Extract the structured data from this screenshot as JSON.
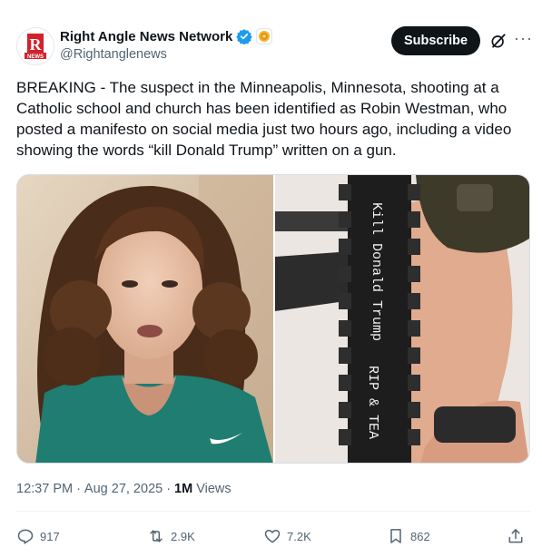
{
  "account": {
    "name": "Right Angle News Network",
    "handle": "@Rightanglenews",
    "avatar_letter": "R",
    "avatar_subtext": "NEWS"
  },
  "header": {
    "subscribe_label": "Subscribe",
    "more_label": "···"
  },
  "post": {
    "text": "BREAKING - The suspect in the Minneapolis, Minnesota, shooting at a Catholic school and church has been identified as Robin Westman, who posted a manifesto on social media just two hours ago, including a video showing the words “kill Donald Trump” written on a gun.",
    "time": "12:37 PM",
    "date": "Aug 27, 2025",
    "views_count": "1M",
    "views_label": "Views"
  },
  "media": {
    "gun_text_1": "Kill Donald Trump",
    "gun_text_2": "RIP & TEA"
  },
  "actions": {
    "replies": "917",
    "reposts": "2.9K",
    "likes": "7.2K",
    "bookmarks": "862"
  },
  "colors": {
    "verified": "#1d9bf0",
    "subscribe_bg": "#0f1419",
    "secondary_text": "#536471",
    "brand_red": "#d4202a"
  }
}
